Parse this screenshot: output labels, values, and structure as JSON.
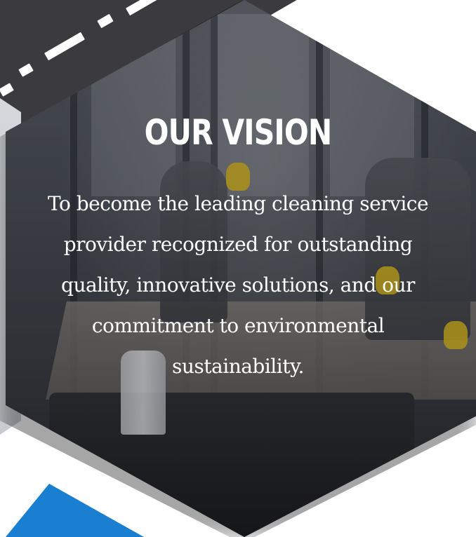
{
  "section": {
    "title": "OUR VISION",
    "body": "To become the leading cleaning service\nprovider recognized for outstanding\nquality,  innovative solutions, and our\ncommitment  to environmental\nsustainability."
  },
  "colors": {
    "road": "#3b3b3d",
    "accent_blue": "#1a7fd0",
    "text": "#ffffff"
  },
  "image": {
    "description_icon": "office-cleaning-photo"
  }
}
